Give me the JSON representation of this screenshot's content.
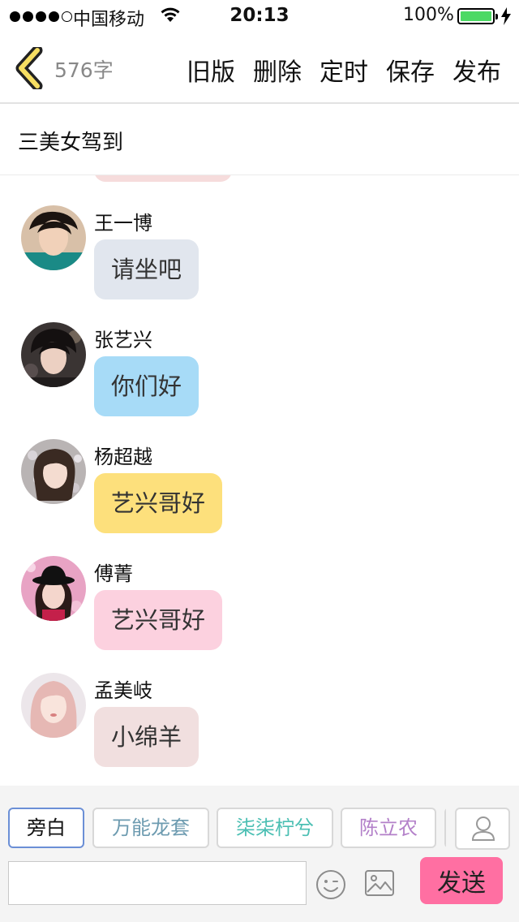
{
  "status_bar": {
    "carrier": "中国移动",
    "time": "20:13",
    "battery": "100%",
    "battery_level": 1.0
  },
  "nav": {
    "back_icon": "chevron-left-icon",
    "word_count": "576字",
    "actions": [
      "旧版",
      "删除",
      "定时",
      "保存",
      "发布"
    ]
  },
  "story": {
    "title": "三美女驾到"
  },
  "messages": [
    {
      "sender": "王一博",
      "text": "请坐吧",
      "bubble_color": "#e1e6ee"
    },
    {
      "sender": "张艺兴",
      "text": "你们好",
      "bubble_color": "#a7dbf7"
    },
    {
      "sender": "杨超越",
      "text": "艺兴哥好",
      "bubble_color": "#fde07c"
    },
    {
      "sender": "傅菁",
      "text": "艺兴哥好",
      "bubble_color": "#fcd1df"
    },
    {
      "sender": "孟美岐",
      "text": "小绵羊",
      "bubble_color": "#f1dfdf"
    }
  ],
  "composer": {
    "roles": [
      {
        "label": "旁白",
        "color": "#111111"
      },
      {
        "label": "万能龙套",
        "color": "#6d9bb0"
      },
      {
        "label": "柒柒柠兮",
        "color": "#4bbfb3"
      },
      {
        "label": "陈立农",
        "color": "#b380c9"
      }
    ],
    "input_value": "",
    "send_label": "发送",
    "send_color": "#ff6fa2",
    "emoji_icon": "emoji-icon",
    "image_icon": "image-icon",
    "role_icon": "user-icon"
  }
}
